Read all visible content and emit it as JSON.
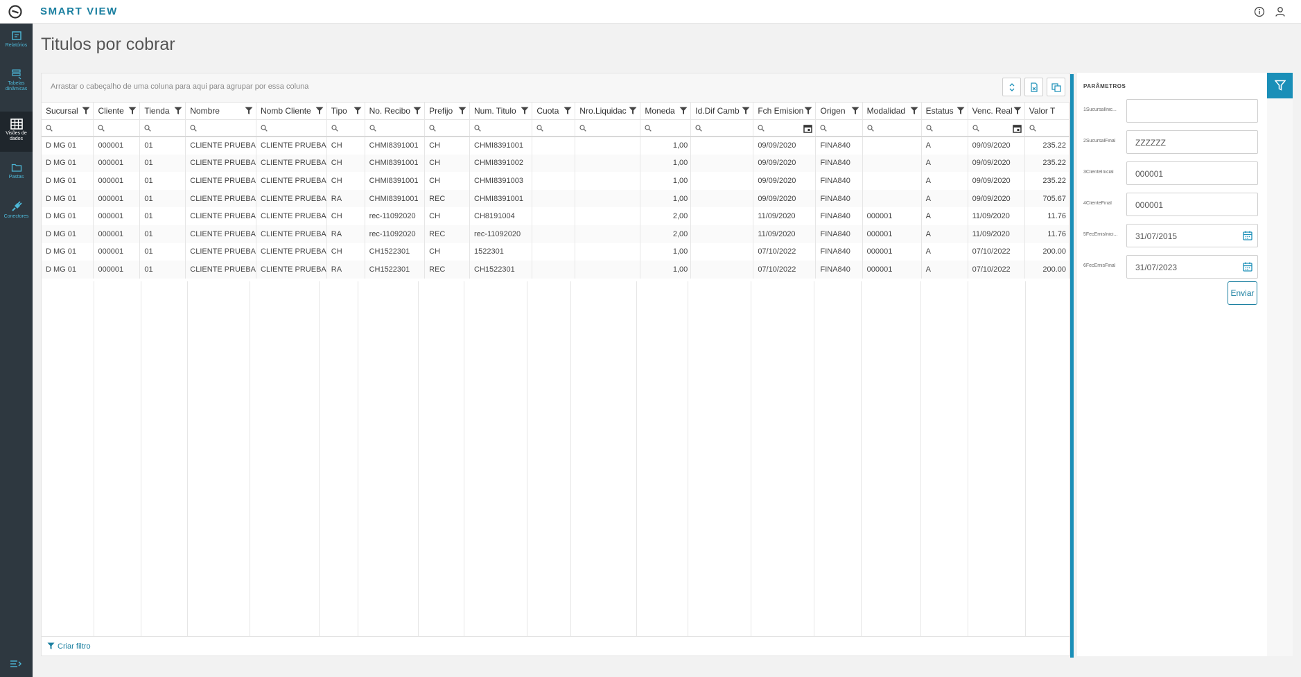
{
  "app": {
    "title": "SMART VIEW",
    "logo_icon": "totvs-logo-icon",
    "info_icon": "info-icon",
    "user_icon": "user-icon"
  },
  "sidebar": {
    "items": [
      {
        "label": "Relatórios",
        "icon": "report-icon",
        "active": false
      },
      {
        "label": "Tabelas dinâmicas",
        "icon": "pivot-table-icon",
        "active": false
      },
      {
        "label": "Visões de dados",
        "icon": "grid-icon",
        "active": true
      },
      {
        "label": "Pastas",
        "icon": "folder-icon",
        "active": false
      },
      {
        "label": "Conectores",
        "icon": "plug-icon",
        "active": false
      }
    ],
    "collapse_icon": "collapse-menu-icon"
  },
  "page": {
    "title": "Titulos por cobrar"
  },
  "grid": {
    "group_hint": "Arrastar o cabeçalho de uma coluna para aqui para agrupar por essa coluna",
    "toolbar_icons": [
      "expand-collapse-icon",
      "export-excel-icon",
      "column-chooser-icon"
    ],
    "columns": [
      "Sucursal",
      "Cliente",
      "Tienda",
      "Nombre",
      "Nomb Cliente",
      "Tipo",
      "No. Recibo",
      "Prefijo",
      "Num. Titulo",
      "Cuota",
      "Nro.Liquidac",
      "Moneda",
      "Id.Dif Camb",
      "Fch Emision",
      "Origen",
      "Modalidad",
      "Estatus",
      "Venc. Real",
      "Valor T"
    ],
    "rows": [
      {
        "cells": [
          "D MG 01",
          "000001",
          "01",
          "CLIENTE PRUEBA",
          "CLIENTE PRUEBA",
          "CH",
          "CHMI8391001",
          "CH",
          "CHMI8391001",
          "",
          "",
          "1,00",
          "",
          "09/09/2020",
          "FINA840",
          "",
          "A",
          "09/09/2020",
          "235.22"
        ]
      },
      {
        "cells": [
          "D MG 01",
          "000001",
          "01",
          "CLIENTE PRUEBA",
          "CLIENTE PRUEBA",
          "CH",
          "CHMI8391001",
          "CH",
          "CHMI8391002",
          "",
          "",
          "1,00",
          "",
          "09/09/2020",
          "FINA840",
          "",
          "A",
          "09/09/2020",
          "235.22"
        ]
      },
      {
        "cells": [
          "D MG 01",
          "000001",
          "01",
          "CLIENTE PRUEBA",
          "CLIENTE PRUEBA",
          "CH",
          "CHMI8391001",
          "CH",
          "CHMI8391003",
          "",
          "",
          "1,00",
          "",
          "09/09/2020",
          "FINA840",
          "",
          "A",
          "09/09/2020",
          "235.22"
        ]
      },
      {
        "cells": [
          "D MG 01",
          "000001",
          "01",
          "CLIENTE PRUEBA",
          "CLIENTE PRUEBA",
          "RA",
          "CHMI8391001",
          "REC",
          "CHMI8391001",
          "",
          "",
          "1,00",
          "",
          "09/09/2020",
          "FINA840",
          "",
          "A",
          "09/09/2020",
          "705.67"
        ]
      },
      {
        "cells": [
          "D MG 01",
          "000001",
          "01",
          "CLIENTE PRUEBA",
          "CLIENTE PRUEBA",
          "CH",
          "rec-11092020",
          "CH",
          "CH8191004",
          "",
          "",
          "2,00",
          "",
          "11/09/2020",
          "FINA840",
          "000001",
          "A",
          "11/09/2020",
          "11.76"
        ]
      },
      {
        "cells": [
          "D MG 01",
          "000001",
          "01",
          "CLIENTE PRUEBA",
          "CLIENTE PRUEBA",
          "RA",
          "rec-11092020",
          "REC",
          "rec-11092020",
          "",
          "",
          "2,00",
          "",
          "11/09/2020",
          "FINA840",
          "000001",
          "A",
          "11/09/2020",
          "11.76"
        ]
      },
      {
        "cells": [
          "D MG 01",
          "000001",
          "01",
          "CLIENTE PRUEBA",
          "CLIENTE PRUEBA",
          "CH",
          "CH1522301",
          "CH",
          "1522301",
          "",
          "",
          "1,00",
          "",
          "07/10/2022",
          "FINA840",
          "000001",
          "A",
          "07/10/2022",
          "200.00"
        ]
      },
      {
        "cells": [
          "D MG 01",
          "000001",
          "01",
          "CLIENTE PRUEBA",
          "CLIENTE PRUEBA",
          "RA",
          "CH1522301",
          "REC",
          "CH1522301",
          "",
          "",
          "1,00",
          "",
          "07/10/2022",
          "FINA840",
          "000001",
          "A",
          "07/10/2022",
          "200.00"
        ]
      }
    ],
    "footer_link": "Criar filtro"
  },
  "params": {
    "title": "PARÂMETROS",
    "fields": [
      {
        "label": "1SucursalInic...",
        "value": "",
        "has_calendar": false
      },
      {
        "label": "2SucursalFinal",
        "value": "ZZZZZZ",
        "has_calendar": false
      },
      {
        "label": "3ClienteInicial",
        "value": "000001",
        "has_calendar": false
      },
      {
        "label": "4ClienteFinal",
        "value": "000001",
        "has_calendar": false
      },
      {
        "label": "5FecEmisInici...",
        "value": "31/07/2015",
        "has_calendar": true
      },
      {
        "label": "6FecEmisFinal",
        "value": "31/07/2023",
        "has_calendar": true
      }
    ],
    "submit_label": "Enviar",
    "filter_tab_icon": "filter-icon"
  },
  "colors": {
    "accent": "#1a8fb8",
    "sidebar_bg": "#2e3840",
    "title_color": "#1a7fa0"
  }
}
